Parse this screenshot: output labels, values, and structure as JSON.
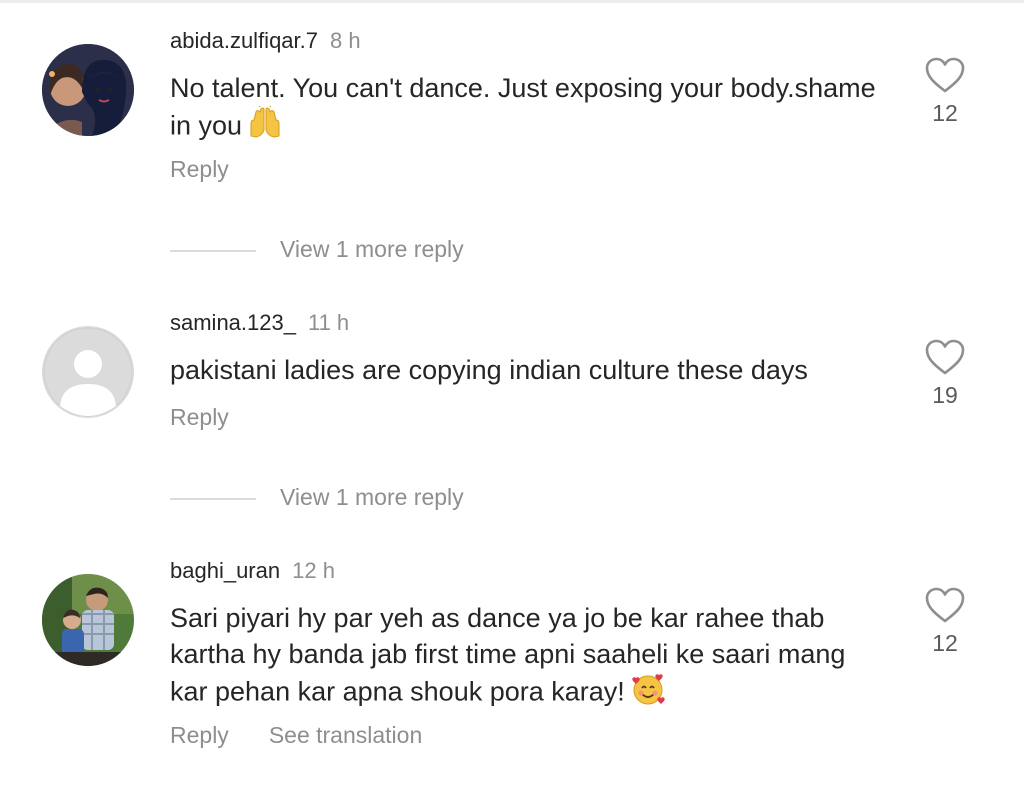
{
  "comments": [
    {
      "username": "abida.zulfiqar.7",
      "time": "8 h",
      "text": "No talent. You can't dance. Just exposing your body.shame in you",
      "emoji": "raising-hands",
      "reply_label": "Reply",
      "likes": "12",
      "view_more": "View 1 more reply"
    },
    {
      "username": "samina.123_",
      "time": "11 h",
      "text": "pakistani ladies are copying indian culture these days",
      "reply_label": "Reply",
      "likes": "19",
      "view_more": "View 1 more reply"
    },
    {
      "username": "baghi_uran",
      "time": "12 h",
      "text": "Sari piyari hy par yeh as dance ya jo be kar rahee thab kartha hy banda jab first time apni saaheli ke saari mang kar pehan kar apna shouk pora karay!",
      "emoji": "smiling-face-with-hearts",
      "reply_label": "Reply",
      "translate_label": "See translation",
      "likes": "12"
    }
  ],
  "icons": {
    "like": "heart-outline-icon"
  },
  "colors": {
    "primary_text": "#262626",
    "secondary_text": "#8e8e8e",
    "divider": "#dbdbdb"
  }
}
